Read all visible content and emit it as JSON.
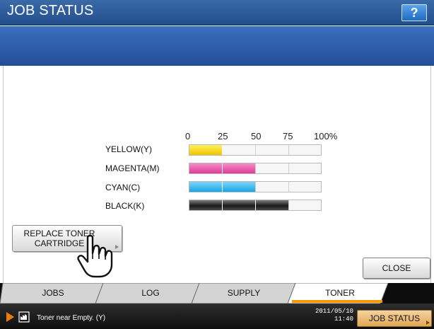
{
  "header": {
    "title": "JOB STATUS",
    "help_label": "?"
  },
  "toner": {
    "scale_labels": [
      "0",
      "25",
      "50",
      "75",
      "100%"
    ],
    "rows": [
      {
        "label": "YELLOW(Y)",
        "level_percent": 25,
        "color": "#f1c500"
      },
      {
        "label": "MAGENTA(M)",
        "level_percent": 50,
        "color": "#e03a99"
      },
      {
        "label": "CYAN(C)",
        "level_percent": 50,
        "color": "#15a7e6"
      },
      {
        "label": "BLACK(K)",
        "level_percent": 75,
        "color": "#1b1b1b"
      }
    ],
    "replace_button_label": "REPLACE TONER CARTRIDGE"
  },
  "close_label": "CLOSE",
  "tabs": [
    {
      "label": "JOBS",
      "active": false
    },
    {
      "label": "LOG",
      "active": false
    },
    {
      "label": "SUPPLY",
      "active": false
    },
    {
      "label": "TONER",
      "active": true
    }
  ],
  "status": {
    "message": "Toner near Empty. (Y)",
    "date": "2011/05/10",
    "time": "11:40",
    "job_status_label": "JOB STATUS"
  },
  "icons": {
    "help": "question-mark-icon",
    "pointer": "hand-pointer-icon",
    "status_play": "play-triangle-icon",
    "status_toner": "toner-icon"
  },
  "colors": {
    "title_bar": "#234f8c",
    "tab_active_accent": "#f29a00",
    "job_status_button": "#e0a855"
  }
}
